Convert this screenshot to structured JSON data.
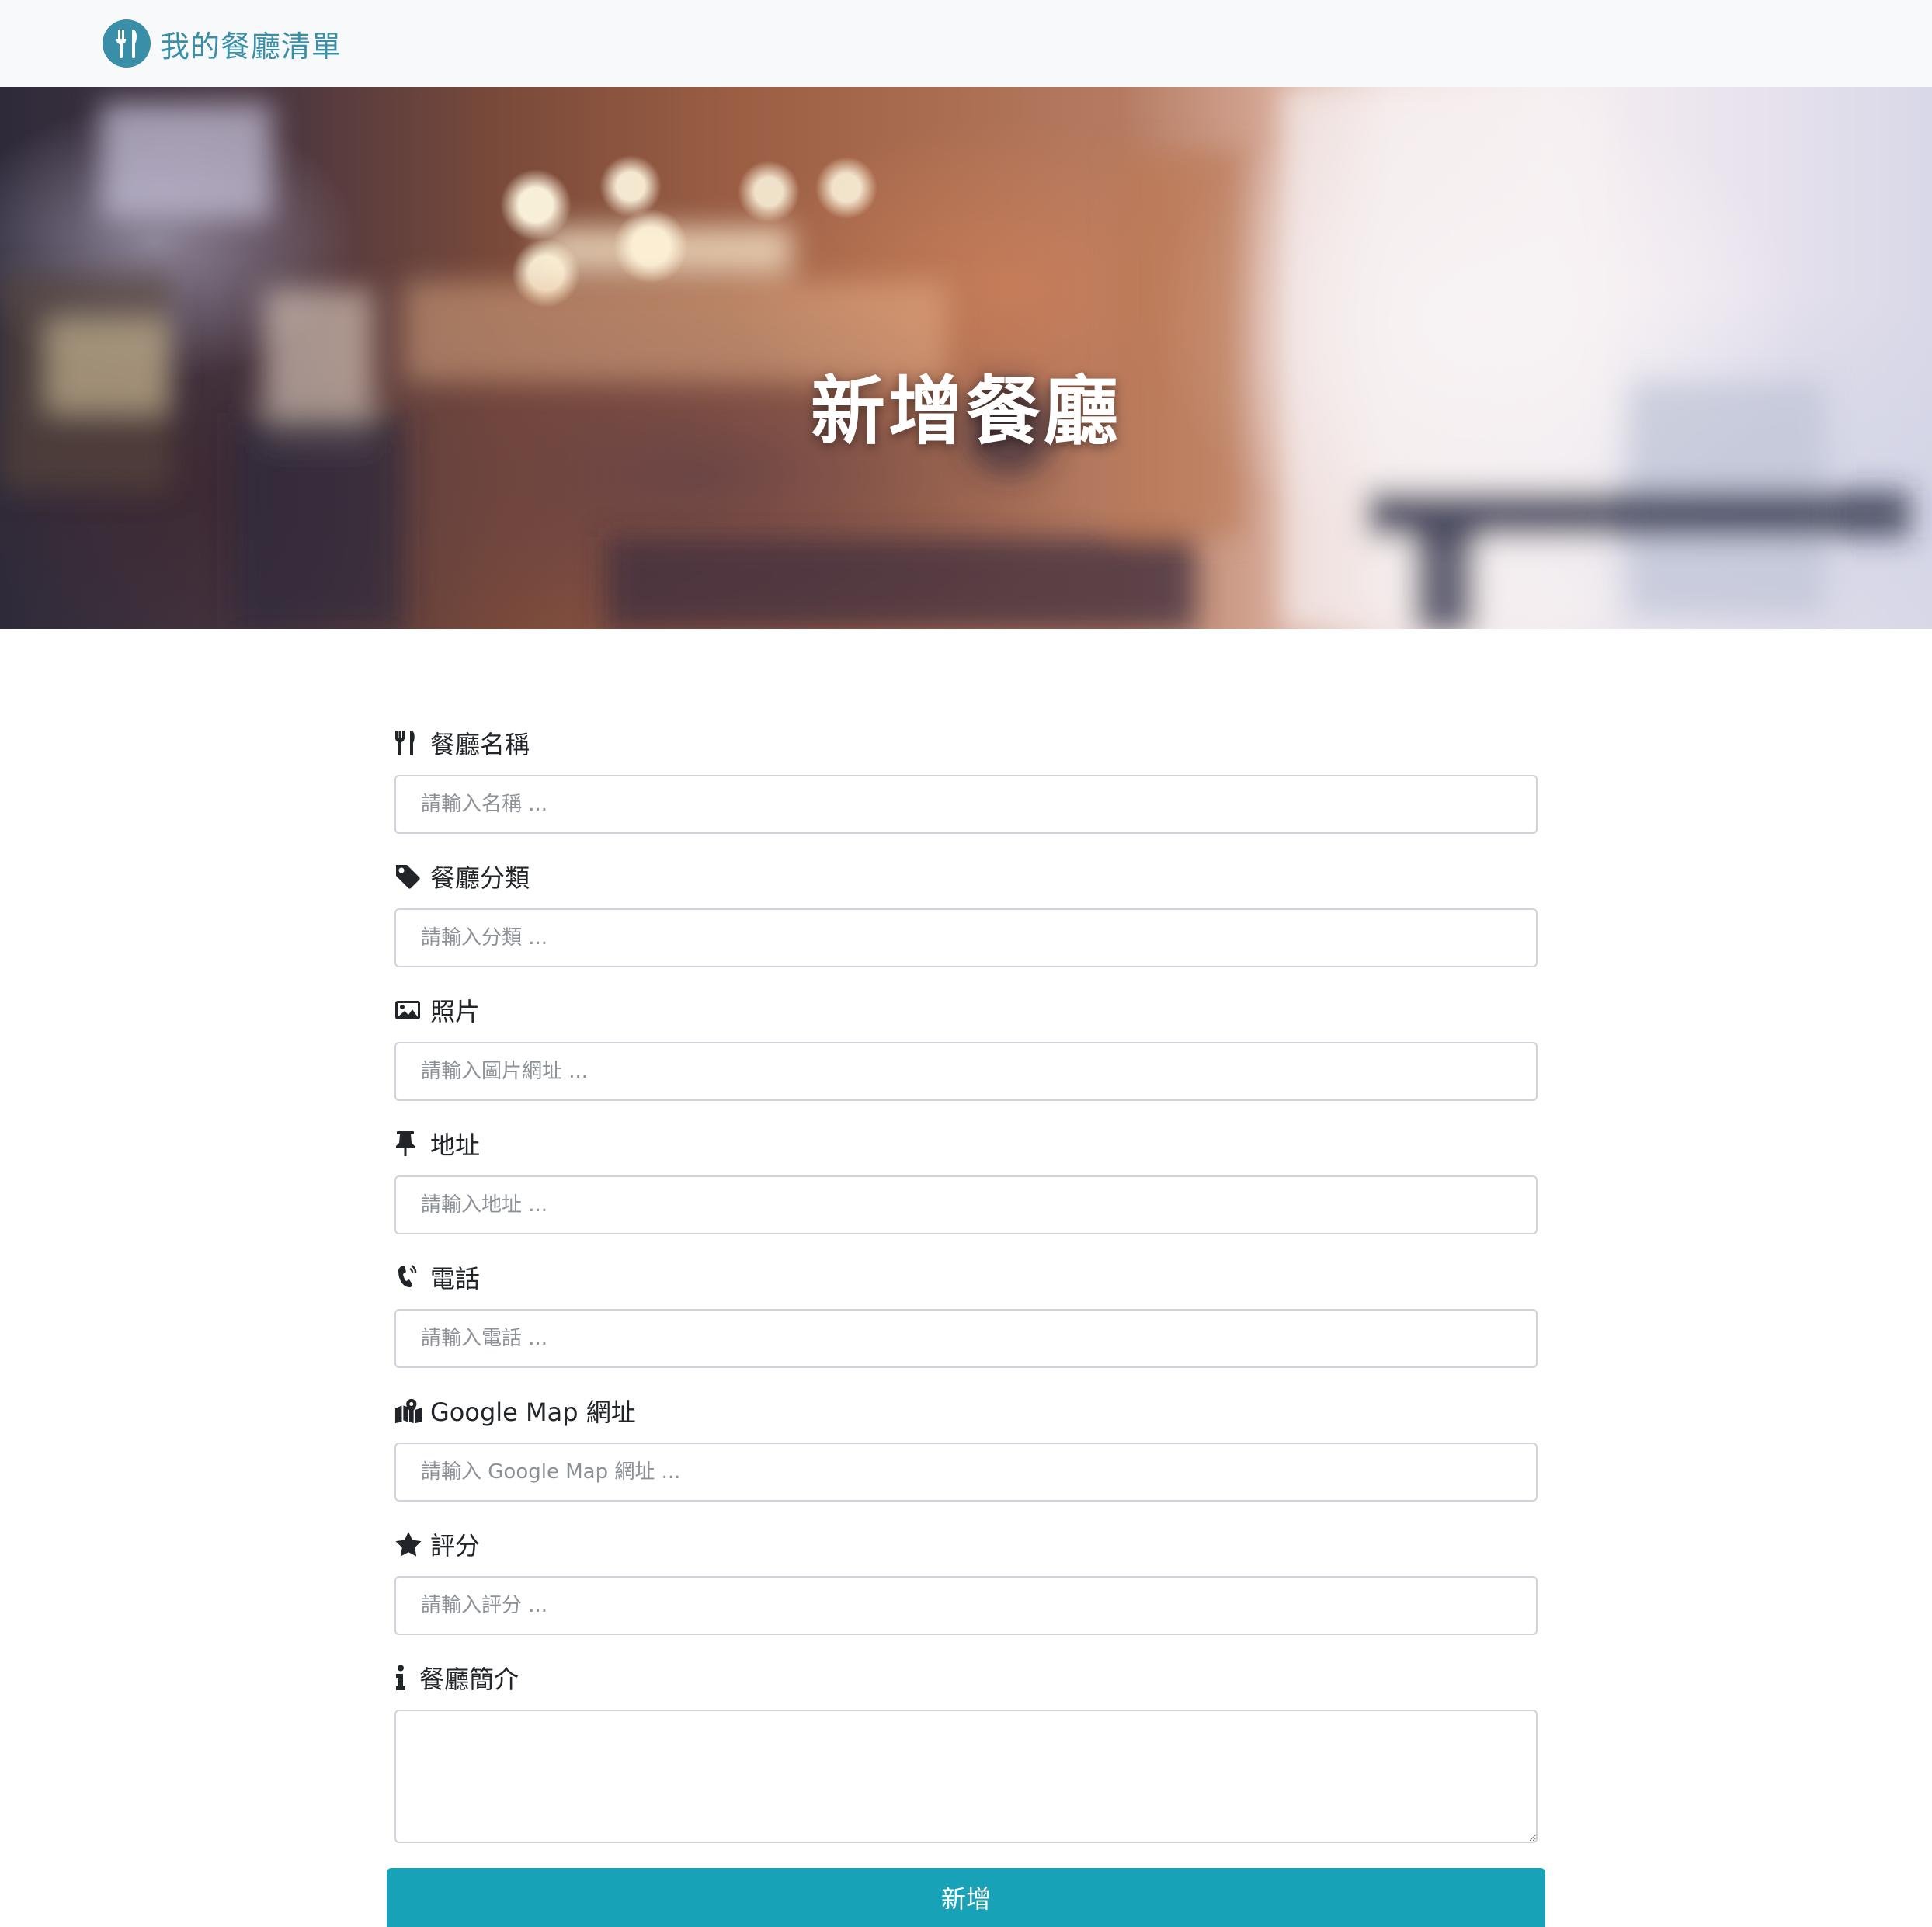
{
  "navbar": {
    "brand_title": "我的餐廳清單",
    "brand_icon": "utensils-icon",
    "brand_color": "#3a8fa8"
  },
  "banner": {
    "title": "新增餐廳"
  },
  "form": {
    "fields": [
      {
        "label": "餐廳名稱",
        "icon": "utensils-icon",
        "placeholder": "請輸入名稱 ...",
        "value": ""
      },
      {
        "label": "餐廳分類",
        "icon": "tag-icon",
        "placeholder": "請輸入分類 ...",
        "value": ""
      },
      {
        "label": "照片",
        "icon": "image-icon",
        "placeholder": "請輸入圖片網址 ...",
        "value": ""
      },
      {
        "label": "地址",
        "icon": "thumbtack-icon",
        "placeholder": "請輸入地址 ...",
        "value": ""
      },
      {
        "label": "電話",
        "icon": "phone-volume-icon",
        "placeholder": "請輸入電話 ...",
        "value": ""
      },
      {
        "label": "Google Map 網址",
        "icon": "map-marked-icon",
        "placeholder": "請輸入 Google Map 網址 ...",
        "value": ""
      },
      {
        "label": "評分",
        "icon": "star-icon",
        "placeholder": "請輸入評分 ...",
        "value": ""
      }
    ],
    "description": {
      "label": "餐廳簡介",
      "icon": "info-icon",
      "value": ""
    },
    "submit_label": "新增",
    "submit_color": "#17a2b8"
  }
}
